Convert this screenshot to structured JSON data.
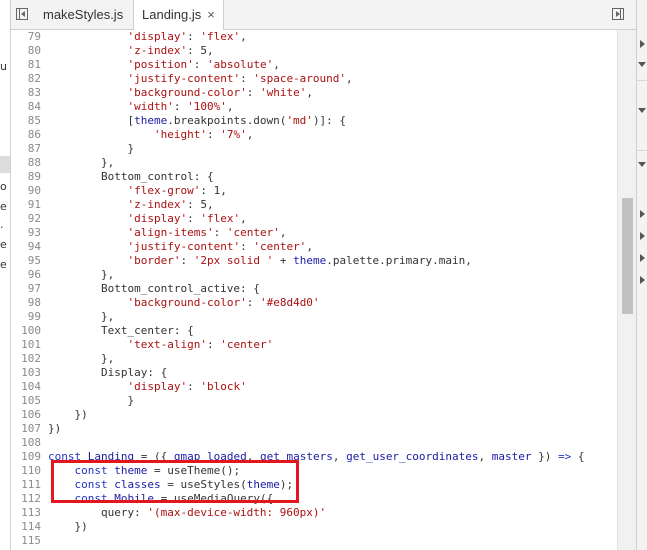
{
  "tabs": [
    {
      "label": "makeStyles.js",
      "active": false
    },
    {
      "label": "Landing.js",
      "active": true,
      "close": "×"
    }
  ],
  "left_strip_chars": [
    "u",
    "o",
    "e",
    ".",
    "e",
    "e"
  ],
  "lines": [
    {
      "n": "79",
      "code": [
        [
          "            ",
          ""
        ],
        [
          "'display'",
          "str"
        ],
        [
          ": ",
          ""
        ],
        [
          "'flex'",
          "str"
        ],
        [
          ",",
          ""
        ]
      ]
    },
    {
      "n": "80",
      "code": [
        [
          "            ",
          ""
        ],
        [
          "'z-index'",
          "str"
        ],
        [
          ": 5,",
          ""
        ]
      ]
    },
    {
      "n": "81",
      "code": [
        [
          "            ",
          ""
        ],
        [
          "'position'",
          "str"
        ],
        [
          ": ",
          ""
        ],
        [
          "'absolute'",
          "str"
        ],
        [
          ",",
          ""
        ]
      ]
    },
    {
      "n": "82",
      "code": [
        [
          "            ",
          ""
        ],
        [
          "'justify-content'",
          "str"
        ],
        [
          ": ",
          ""
        ],
        [
          "'space-around'",
          "str"
        ],
        [
          ",",
          ""
        ]
      ]
    },
    {
      "n": "83",
      "code": [
        [
          "            ",
          ""
        ],
        [
          "'background-color'",
          "str"
        ],
        [
          ": ",
          ""
        ],
        [
          "'white'",
          "str"
        ],
        [
          ",",
          ""
        ]
      ]
    },
    {
      "n": "84",
      "code": [
        [
          "            ",
          ""
        ],
        [
          "'width'",
          "str"
        ],
        [
          ": ",
          ""
        ],
        [
          "'100%'",
          "str"
        ],
        [
          ",",
          ""
        ]
      ]
    },
    {
      "n": "85",
      "code": [
        [
          "            [",
          ""
        ],
        [
          "theme",
          "var"
        ],
        [
          ".breakpoints.down(",
          ""
        ],
        [
          "'md'",
          "str"
        ],
        [
          ")]: {",
          ""
        ]
      ]
    },
    {
      "n": "86",
      "code": [
        [
          "                ",
          ""
        ],
        [
          "'height'",
          "str"
        ],
        [
          ": ",
          ""
        ],
        [
          "'7%'",
          "str"
        ],
        [
          ",",
          ""
        ]
      ]
    },
    {
      "n": "87",
      "code": [
        [
          "            }",
          ""
        ]
      ]
    },
    {
      "n": "88",
      "code": [
        [
          "        },",
          ""
        ]
      ]
    },
    {
      "n": "89",
      "code": [
        [
          "        Bottom_control: {",
          ""
        ]
      ]
    },
    {
      "n": "90",
      "code": [
        [
          "            ",
          ""
        ],
        [
          "'flex-grow'",
          "str"
        ],
        [
          ": 1,",
          ""
        ]
      ]
    },
    {
      "n": "91",
      "code": [
        [
          "            ",
          ""
        ],
        [
          "'z-index'",
          "str"
        ],
        [
          ": 5,",
          ""
        ]
      ]
    },
    {
      "n": "92",
      "code": [
        [
          "            ",
          ""
        ],
        [
          "'display'",
          "str"
        ],
        [
          ": ",
          ""
        ],
        [
          "'flex'",
          "str"
        ],
        [
          ",",
          ""
        ]
      ]
    },
    {
      "n": "93",
      "code": [
        [
          "            ",
          ""
        ],
        [
          "'align-items'",
          "str"
        ],
        [
          ": ",
          ""
        ],
        [
          "'center'",
          "str"
        ],
        [
          ",",
          ""
        ]
      ]
    },
    {
      "n": "94",
      "code": [
        [
          "            ",
          ""
        ],
        [
          "'justify-content'",
          "str"
        ],
        [
          ": ",
          ""
        ],
        [
          "'center'",
          "str"
        ],
        [
          ",",
          ""
        ]
      ]
    },
    {
      "n": "95",
      "code": [
        [
          "            ",
          ""
        ],
        [
          "'border'",
          "str"
        ],
        [
          ": ",
          ""
        ],
        [
          "'2px solid '",
          "str"
        ],
        [
          " + ",
          ""
        ],
        [
          "theme",
          "var"
        ],
        [
          ".palette.primary.main,",
          ""
        ]
      ]
    },
    {
      "n": "96",
      "code": [
        [
          "        },",
          ""
        ]
      ]
    },
    {
      "n": "97",
      "code": [
        [
          "        Bottom_control_active: {",
          ""
        ]
      ]
    },
    {
      "n": "98",
      "code": [
        [
          "            ",
          ""
        ],
        [
          "'background-color'",
          "str"
        ],
        [
          ": ",
          ""
        ],
        [
          "'#e8d4d0'",
          "str"
        ]
      ]
    },
    {
      "n": "99",
      "code": [
        [
          "        },",
          ""
        ]
      ]
    },
    {
      "n": "100",
      "code": [
        [
          "        Text_center: {",
          ""
        ]
      ]
    },
    {
      "n": "101",
      "code": [
        [
          "            ",
          ""
        ],
        [
          "'text-align'",
          "str"
        ],
        [
          ": ",
          ""
        ],
        [
          "'center'",
          "str"
        ]
      ]
    },
    {
      "n": "102",
      "code": [
        [
          "        },",
          ""
        ]
      ]
    },
    {
      "n": "103",
      "code": [
        [
          "        Display: {",
          ""
        ]
      ]
    },
    {
      "n": "104",
      "code": [
        [
          "            ",
          ""
        ],
        [
          "'display'",
          "str"
        ],
        [
          ": ",
          ""
        ],
        [
          "'block'",
          "str"
        ]
      ]
    },
    {
      "n": "105",
      "code": [
        [
          "            }",
          ""
        ]
      ]
    },
    {
      "n": "106",
      "code": [
        [
          "    })",
          ""
        ]
      ]
    },
    {
      "n": "107",
      "code": [
        [
          "})",
          ""
        ]
      ]
    },
    {
      "n": "108",
      "code": [
        [
          "",
          ""
        ]
      ]
    },
    {
      "n": "109",
      "code": [
        [
          "const",
          "kw"
        ],
        [
          " ",
          ""
        ],
        [
          "Landing",
          "var"
        ],
        [
          " = ({ ",
          ""
        ],
        [
          "gmap_loaded",
          "var"
        ],
        [
          ", ",
          ""
        ],
        [
          "get_masters",
          "var"
        ],
        [
          ", ",
          ""
        ],
        [
          "get_user_coordinates",
          "var"
        ],
        [
          ", ",
          ""
        ],
        [
          "master",
          "var"
        ],
        [
          " }) ",
          ""
        ],
        [
          "=>",
          "kw"
        ],
        [
          " {",
          ""
        ]
      ]
    },
    {
      "n": "110",
      "code": [
        [
          "    ",
          ""
        ],
        [
          "const",
          "kw"
        ],
        [
          " ",
          ""
        ],
        [
          "theme",
          "var"
        ],
        [
          " = useTheme();",
          ""
        ]
      ]
    },
    {
      "n": "111",
      "code": [
        [
          "    ",
          ""
        ],
        [
          "const",
          "kw"
        ],
        [
          " ",
          ""
        ],
        [
          "classes",
          "var"
        ],
        [
          " = useStyles(",
          ""
        ],
        [
          "theme",
          "var"
        ],
        [
          ");",
          ""
        ]
      ]
    },
    {
      "n": "112",
      "code": [
        [
          "    ",
          ""
        ],
        [
          "const",
          "kw"
        ],
        [
          " ",
          ""
        ],
        [
          "Mobile",
          "var"
        ],
        [
          " = useMediaQuery({",
          ""
        ]
      ]
    },
    {
      "n": "113",
      "code": [
        [
          "        query: ",
          ""
        ],
        [
          "'(max-device-width: 960px)'",
          "str"
        ]
      ]
    },
    {
      "n": "114",
      "code": [
        [
          "    })",
          ""
        ]
      ]
    },
    {
      "n": "115",
      "code": [
        [
          "",
          ""
        ]
      ]
    }
  ],
  "colors": {
    "highlight_box": "#e3151d",
    "keyword": "#2434c4",
    "string": "#a11111"
  }
}
